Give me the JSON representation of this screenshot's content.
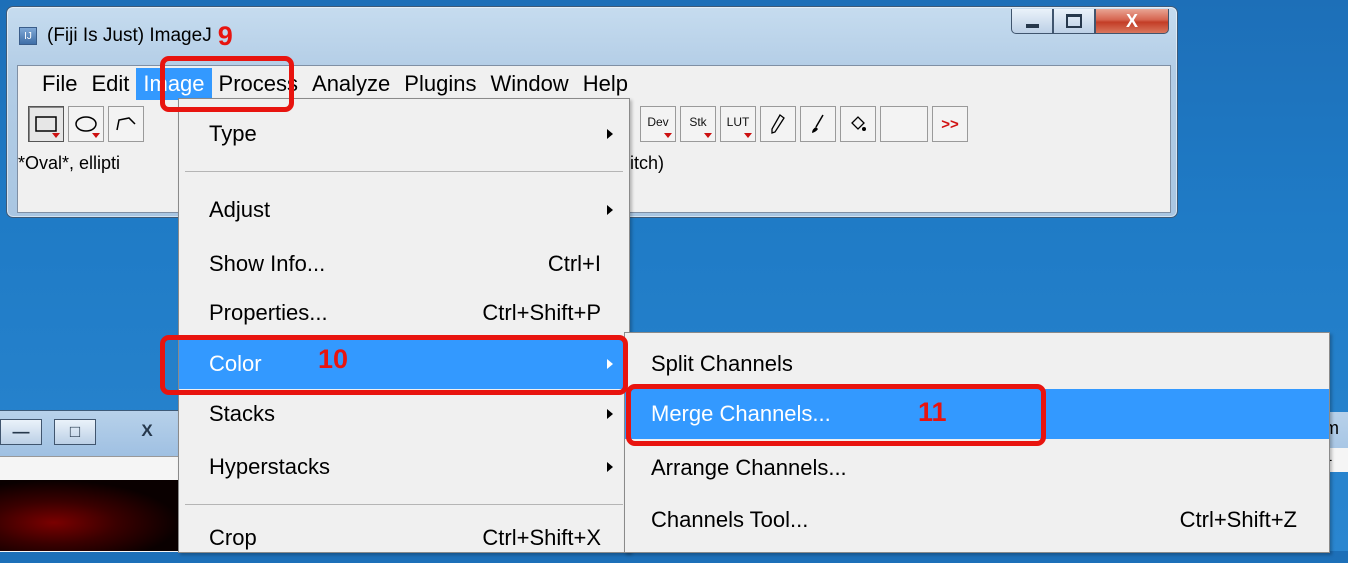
{
  "window": {
    "title": "(Fiji Is Just) ImageJ",
    "title_marker": "9",
    "minimize_glyph": "—",
    "maximize_glyph": "□",
    "close_glyph": "X"
  },
  "menubar": {
    "items": [
      "File",
      "Edit",
      "Image",
      "Process",
      "Analyze",
      "Plugins",
      "Window",
      "Help"
    ],
    "active": "Image"
  },
  "toolbar": {
    "dev_label": "Dev",
    "stk_label": "Stk",
    "lut_label": "LUT",
    "more_label": ">>"
  },
  "status": {
    "left_text": "*Oval*, ellipti",
    "right_text": "itch)"
  },
  "image_menu": {
    "items": [
      {
        "label": "Type",
        "shortcut": "",
        "submenu": true
      },
      {
        "label": "Adjust",
        "shortcut": "",
        "submenu": true
      },
      {
        "label": "Show Info...",
        "shortcut": "Ctrl+I",
        "submenu": false
      },
      {
        "label": "Properties...",
        "shortcut": "Ctrl+Shift+P",
        "submenu": false
      },
      {
        "label": "Color",
        "shortcut": "",
        "submenu": true,
        "highlighted": true
      },
      {
        "label": "Stacks",
        "shortcut": "",
        "submenu": true
      },
      {
        "label": "Hyperstacks",
        "shortcut": "",
        "submenu": true
      },
      {
        "label": "Crop",
        "shortcut": "Ctrl+Shift+X",
        "submenu": false
      }
    ]
  },
  "color_submenu": {
    "items": [
      {
        "label": "Split Channels",
        "shortcut": ""
      },
      {
        "label": "Merge Channels...",
        "shortcut": "",
        "highlighted": true
      },
      {
        "label": "Arrange Channels...",
        "shortcut": ""
      },
      {
        "label": "Channels Tool...",
        "shortcut": "Ctrl+Shift+Z"
      }
    ]
  },
  "annotations": {
    "step_10": "10",
    "step_11": "11"
  },
  "background_windows": {
    "right_partial_text": "m",
    "right_partial_box": "i1",
    "win2_min": "—",
    "win2_max": "□",
    "win2_close": "X"
  },
  "colors": {
    "highlight": "#3399ff",
    "annotation_red": "#e8140f",
    "desktop_blue": "#1f7bc6"
  }
}
